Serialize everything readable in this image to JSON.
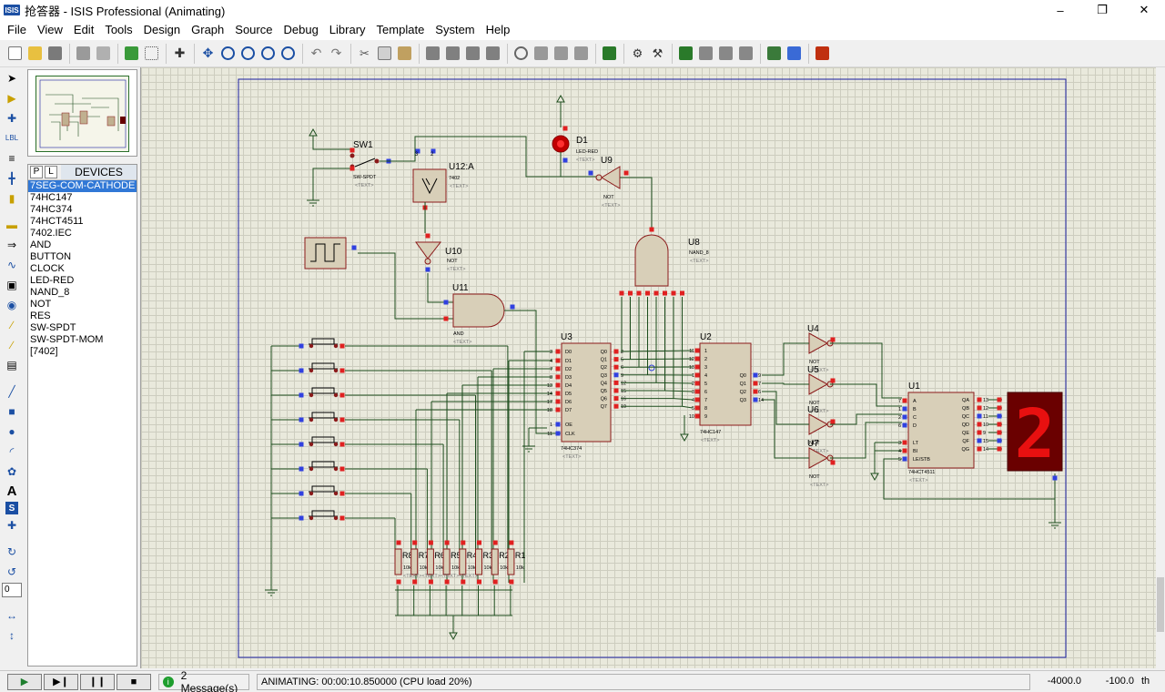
{
  "window": {
    "title": "抢答器 - ISIS Professional (Animating)",
    "icon_label": "ISIS"
  },
  "menu": [
    "File",
    "View",
    "Edit",
    "Tools",
    "Design",
    "Graph",
    "Source",
    "Debug",
    "Library",
    "Template",
    "System",
    "Help"
  ],
  "devices_panel": {
    "tab_p": "P",
    "tab_l": "L",
    "title": "DEVICES",
    "items": [
      "7SEG-COM-CATHODE",
      "74HC147",
      "74HC374",
      "74HCT4511",
      "7402.IEC",
      "AND",
      "BUTTON",
      "CLOCK",
      "LED-RED",
      "NAND_8",
      "NOT",
      "RES",
      "SW-SPDT",
      "SW-SPDT-MOM",
      "[7402]"
    ],
    "selected_index": 0
  },
  "zoom_field": "0",
  "schematic": {
    "components": {
      "sw1": {
        "ref": "SW1",
        "type": "SW-SPDT",
        "text": "<TEXT>"
      },
      "u12": {
        "ref": "U12:A",
        "type": "7402",
        "text": "<TEXT>",
        "pin_3": "3",
        "pin_2": "2"
      },
      "u10": {
        "ref": "U10",
        "type": "NOT",
        "text": "<TEXT>"
      },
      "d1": {
        "ref": "D1",
        "type": "LED-RED",
        "text": "<TEXT>"
      },
      "u9": {
        "ref": "U9",
        "type": "NOT",
        "text": "<TEXT>"
      },
      "u8": {
        "ref": "U8",
        "type": "NAND_8",
        "text": "<TEXT>"
      },
      "u11": {
        "ref": "U11",
        "type": "AND",
        "text": "<TEXT>"
      },
      "u3": {
        "ref": "U3",
        "type": "74HC374",
        "text": "<TEXT>",
        "left_pins": [
          "D0",
          "D1",
          "D2",
          "D3",
          "D4",
          "D5",
          "D6",
          "D7",
          "OE",
          "CLK"
        ],
        "left_nums": [
          "3",
          "4",
          "7",
          "8",
          "13",
          "14",
          "17",
          "18",
          "1",
          "11"
        ],
        "right_pins": [
          "Q0",
          "Q1",
          "Q2",
          "Q3",
          "Q4",
          "Q5",
          "Q6",
          "Q7"
        ],
        "right_nums": [
          "2",
          "5",
          "6",
          "9",
          "12",
          "15",
          "16",
          "19"
        ]
      },
      "u2": {
        "ref": "U2",
        "type": "74HC147",
        "text": "<TEXT>",
        "left_pins": [
          "1",
          "2",
          "3",
          "4",
          "5",
          "6",
          "7",
          "8",
          "9"
        ],
        "left_nums": [
          "11",
          "12",
          "13",
          "1",
          "2",
          "3",
          "4",
          "5",
          "10"
        ],
        "right_pins": [
          "Q0",
          "Q1",
          "Q2",
          "Q3"
        ],
        "right_nums": [
          "9",
          "7",
          "6",
          "14"
        ]
      },
      "u4": {
        "ref": "U4",
        "type": "NOT",
        "text": "<TEXT>"
      },
      "u5": {
        "ref": "U5",
        "type": "NOT",
        "text": "<TEXT>"
      },
      "u6": {
        "ref": "U6",
        "type": "NOT",
        "text": "<TEXT>"
      },
      "u7": {
        "ref": "U7",
        "type": "NOT",
        "text": "<TEXT>"
      },
      "u1": {
        "ref": "U1",
        "type": "74HCT4511",
        "text": "<TEXT>",
        "left_pins": [
          "A",
          "B",
          "C",
          "D",
          "LT",
          "BI",
          "LE/STB"
        ],
        "left_nums": [
          "7",
          "1",
          "2",
          "6",
          "3",
          "4",
          "5"
        ],
        "right_pins": [
          "QA",
          "QB",
          "QC",
          "QD",
          "QE",
          "QF",
          "QG"
        ],
        "right_nums": [
          "13",
          "12",
          "11",
          "10",
          "9",
          "15",
          "14"
        ]
      },
      "display": {
        "digit": "2"
      },
      "resistors": [
        {
          "ref": "R8",
          "value": "10k"
        },
        {
          "ref": "R7",
          "value": "10k"
        },
        {
          "ref": "R6",
          "value": "10k"
        },
        {
          "ref": "R5",
          "value": "10k"
        },
        {
          "ref": "R4",
          "value": "10k"
        },
        {
          "ref": "R3",
          "value": "10k"
        },
        {
          "ref": "R2",
          "value": "10k"
        },
        {
          "ref": "R1",
          "value": "10k"
        }
      ],
      "resistor_text": "<TEXT>"
    }
  },
  "status": {
    "messages": "2 Message(s)",
    "animating": "ANIMATING: 00:00:10.850000 (CPU load 20%)",
    "coord_x": "-4000.0",
    "coord_y": "-100.0",
    "units": "th"
  },
  "colors": {
    "wire": "#1d4d1d",
    "component_fill": "#d8cfb8",
    "component_border": "#8b1a1a",
    "pin_high": "#e02020",
    "pin_low": "#3040e0",
    "border_frame": "#1a20a0",
    "seg_on": "#e81010",
    "seg_bg": "#6a0000"
  }
}
